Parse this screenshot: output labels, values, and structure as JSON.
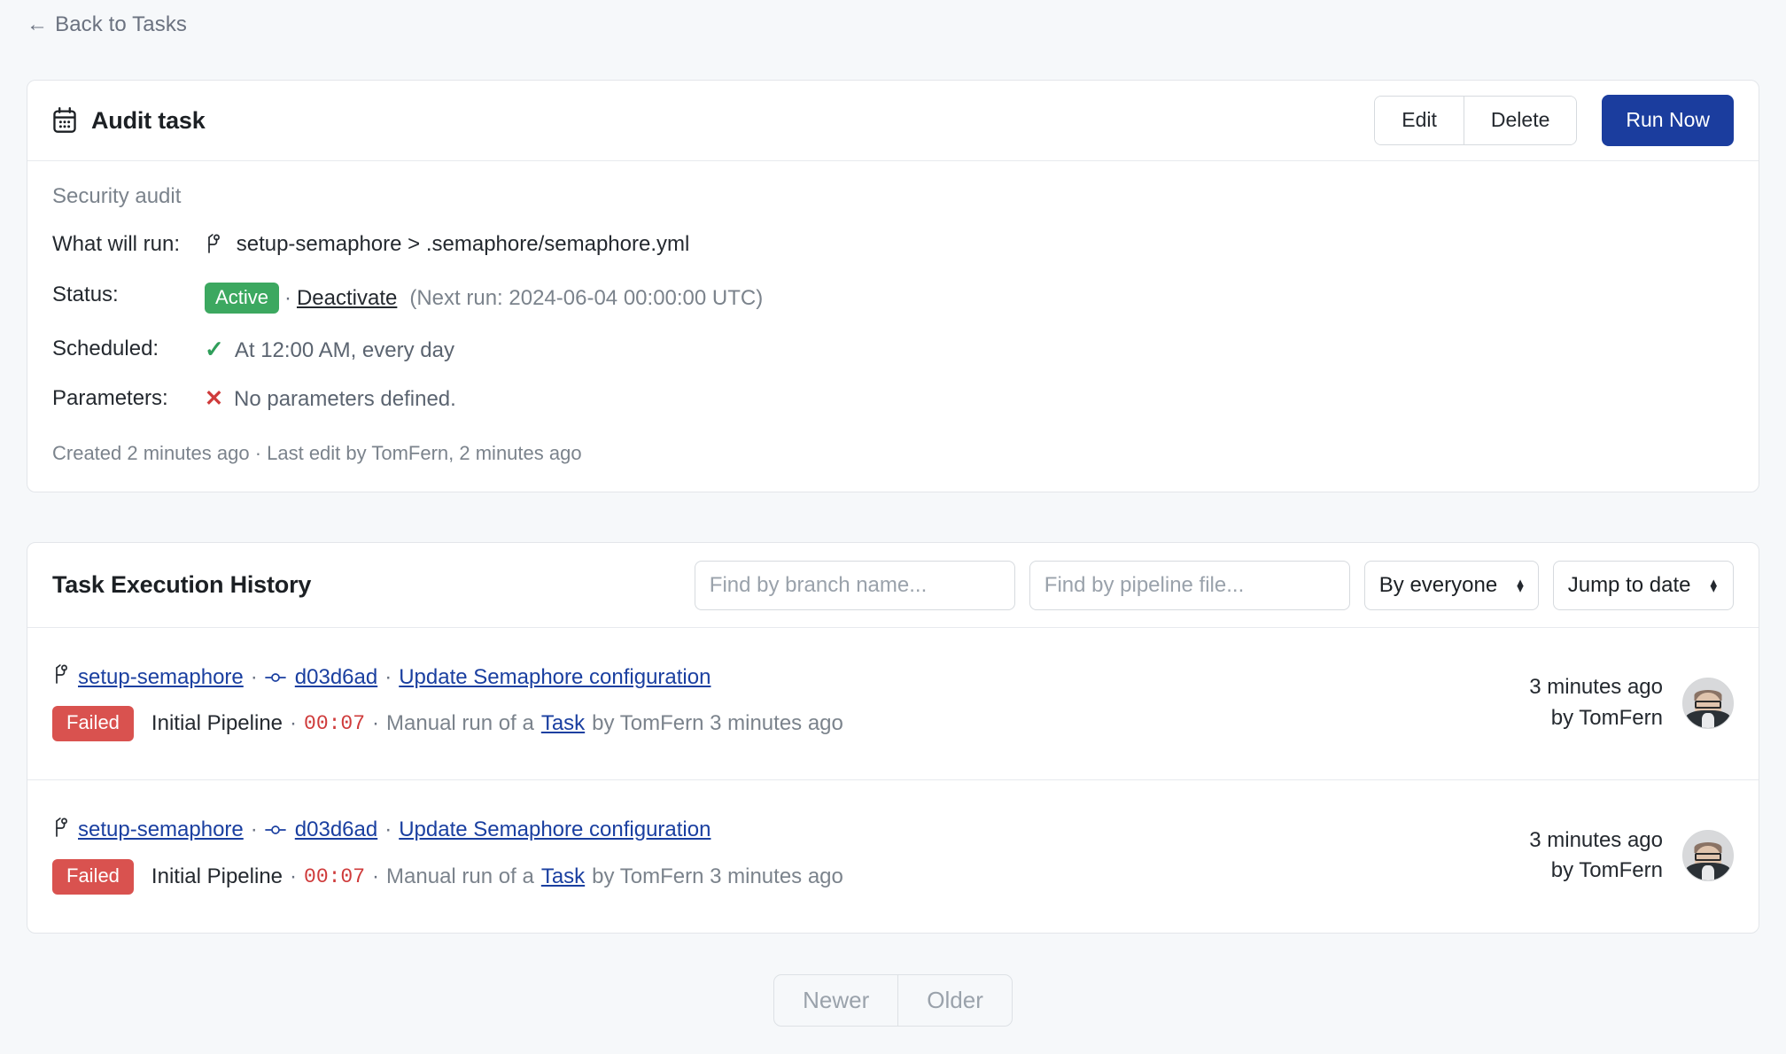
{
  "back_link": {
    "arrow": "←",
    "label": "Back to Tasks"
  },
  "task_card": {
    "icon": "calendar-icon",
    "title": "Audit task",
    "buttons": {
      "edit": "Edit",
      "delete": "Delete",
      "run_now": "Run Now"
    },
    "subtitle": "Security audit",
    "rows": {
      "what_will_run": {
        "label": "What will run:",
        "icon": "git-branch-icon",
        "value": "setup-semaphore > .semaphore/semaphore.yml"
      },
      "status": {
        "label": "Status:",
        "badge": "Active",
        "separator": "·",
        "action": "Deactivate",
        "next_run": "(Next run: 2024-06-04 00:00:00 UTC)"
      },
      "scheduled": {
        "label": "Scheduled:",
        "icon": "check-icon",
        "value": "At 12:00 AM, every day"
      },
      "parameters": {
        "label": "Parameters:",
        "icon": "cross-icon",
        "value": "No parameters defined."
      }
    },
    "footer": "Created 2 minutes ago · Last edit by TomFern, 2 minutes ago"
  },
  "history_card": {
    "title": "Task Execution History",
    "filters": {
      "branch_placeholder": "Find by branch name...",
      "branch_value": "",
      "pipeline_placeholder": "Find by pipeline file...",
      "pipeline_value": "",
      "owner_select": "By everyone",
      "date_select": "Jump to date"
    },
    "rows": [
      {
        "branch_icon": "git-branch-icon",
        "branch": "setup-semaphore",
        "sep1": "·",
        "commit_icon": "git-commit-icon",
        "commit": "d03d6ad",
        "sep2": "·",
        "message": "Update Semaphore configuration",
        "status": "Failed",
        "pipeline": "Initial Pipeline",
        "sep3": "·",
        "duration": "00:07",
        "sep4": "·",
        "trigger_prefix": "Manual run of a",
        "trigger_link": "Task",
        "trigger_suffix": "by TomFern 3 minutes ago",
        "meta_time": "3 minutes ago",
        "meta_author": "by TomFern",
        "avatar": "user-avatar"
      },
      {
        "branch_icon": "git-branch-icon",
        "branch": "setup-semaphore",
        "sep1": "·",
        "commit_icon": "git-commit-icon",
        "commit": "d03d6ad",
        "sep2": "·",
        "message": "Update Semaphore configuration",
        "status": "Failed",
        "pipeline": "Initial Pipeline",
        "sep3": "·",
        "duration": "00:07",
        "sep4": "·",
        "trigger_prefix": "Manual run of a",
        "trigger_link": "Task",
        "trigger_suffix": "by TomFern 3 minutes ago",
        "meta_time": "3 minutes ago",
        "meta_author": "by TomFern",
        "avatar": "user-avatar"
      }
    ]
  },
  "pagination": {
    "newer": "Newer",
    "older": "Older"
  },
  "colors": {
    "page_bg": "#f6f8fa",
    "primary": "#1b3d9e",
    "active_badge": "#3ca860",
    "failed_badge": "#d9524f",
    "link_blue": "#1a3fa0",
    "duration_red": "#cf3b3b",
    "check_green": "#2f9e5a",
    "cross_red": "#cf3b3b"
  }
}
